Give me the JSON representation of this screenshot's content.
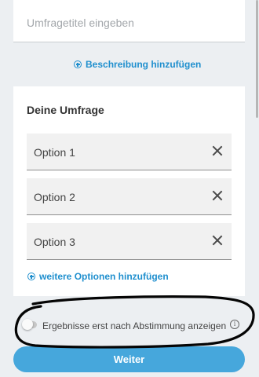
{
  "title_field": {
    "value": "",
    "placeholder": "Umfragetitel eingeben"
  },
  "description_link": {
    "label": "Beschreibung hinzufügen",
    "icon": "plus-circle-icon"
  },
  "survey": {
    "heading": "Deine Umfrage",
    "options": [
      {
        "label": "Option 1",
        "remove_icon": "close-icon"
      },
      {
        "label": "Option 2",
        "remove_icon": "close-icon"
      },
      {
        "label": "Option 3",
        "remove_icon": "close-icon"
      }
    ],
    "add_options_link": {
      "label": "weitere Optionen hinzufügen",
      "icon": "plus-circle-icon"
    }
  },
  "results_toggle": {
    "label": "Ergebnisse erst nach Abstimmung anzeigen",
    "checked": false,
    "info_icon": "info-icon",
    "info_glyph": "i"
  },
  "submit": {
    "label": "Weiter"
  },
  "colors": {
    "accent": "#1f8fce",
    "button": "#46a7dc",
    "background": "#eceff2"
  }
}
